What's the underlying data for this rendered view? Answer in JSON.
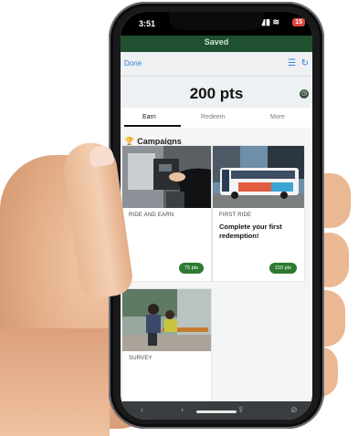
{
  "status_bar": {
    "time": "3:51",
    "battery": "15"
  },
  "banner": {
    "text": "Saved"
  },
  "nav": {
    "done_label": "Done"
  },
  "points": {
    "value": "200 pts"
  },
  "tabs": [
    {
      "label": "Earn",
      "active": true
    },
    {
      "label": "Redeem",
      "active": false
    },
    {
      "label": "More",
      "active": false
    }
  ],
  "section": {
    "title": "Campaigns"
  },
  "campaigns": [
    {
      "label": "RIDE AND EARN",
      "description": "",
      "badge": "75 pts"
    },
    {
      "label": "FIRST RIDE",
      "description": "Complete your first redemption!",
      "badge": "150 pts"
    },
    {
      "label": "SURVEY",
      "description": "",
      "badge": ""
    }
  ],
  "colors": {
    "accent": "#2f80d9",
    "badge": "#2f7a33",
    "banner": "#1f5131"
  }
}
